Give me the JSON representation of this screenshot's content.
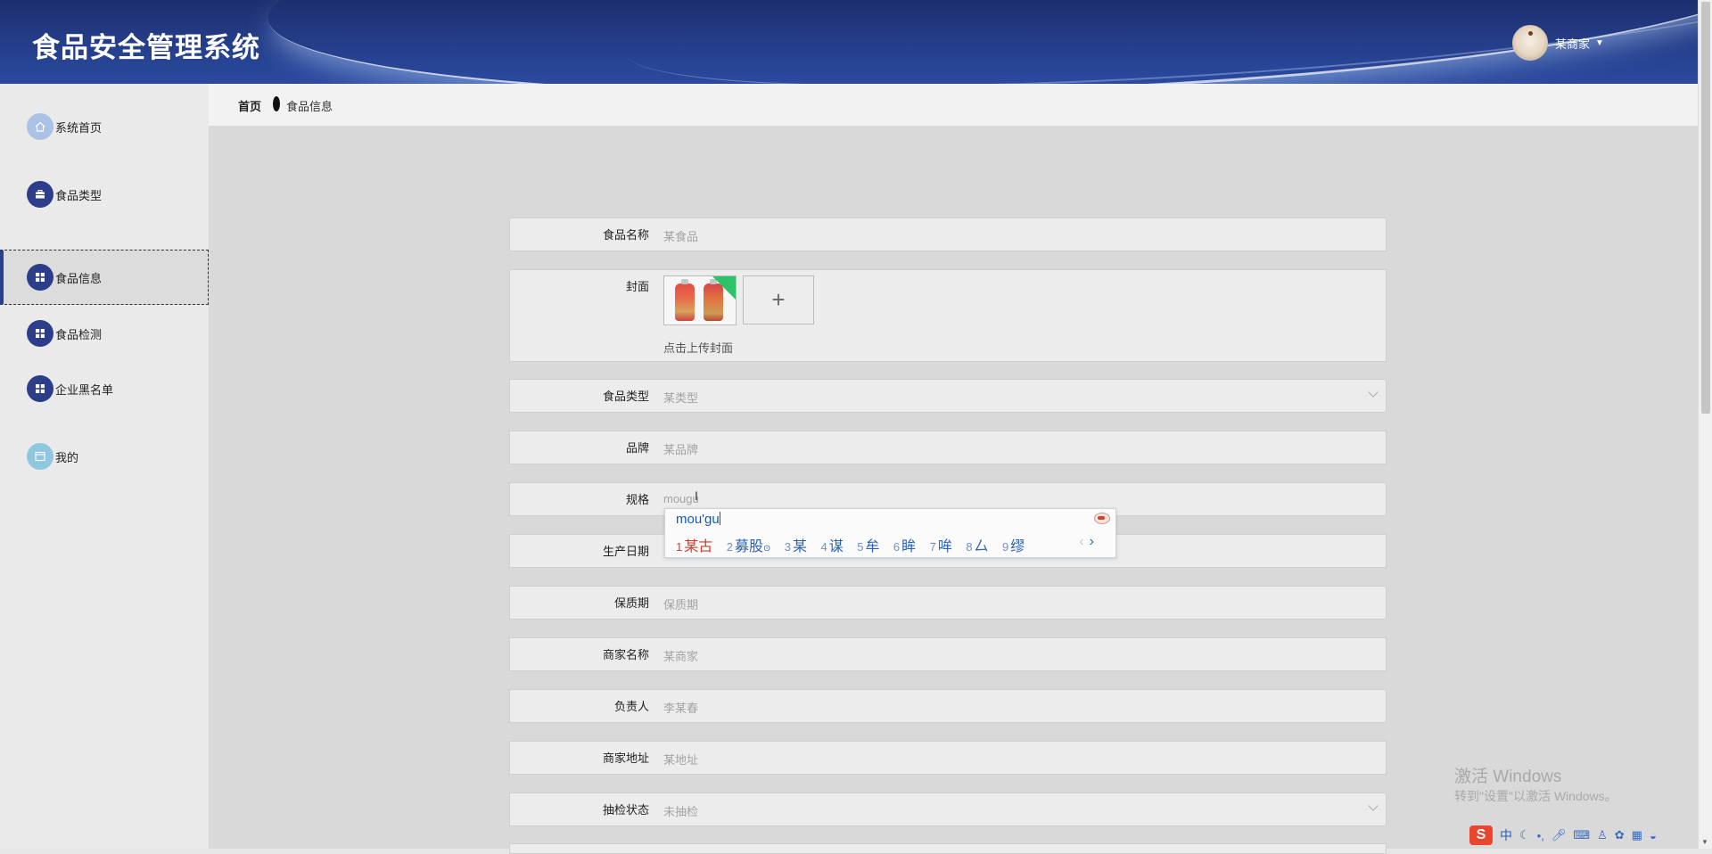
{
  "header": {
    "title": "食品安全管理系统",
    "user_name": "某商家"
  },
  "sidebar": {
    "items": [
      {
        "label": "系统首页",
        "icon": "home-icon"
      },
      {
        "label": "食品类型",
        "icon": "briefcase-icon"
      },
      {
        "label": "食品信息",
        "icon": "grid-icon",
        "active": true
      },
      {
        "label": "食品检测",
        "icon": "grid-icon"
      },
      {
        "label": "企业黑名单",
        "icon": "grid-icon"
      },
      {
        "label": "我的",
        "icon": "window-icon"
      }
    ]
  },
  "breadcrumb": {
    "home": "首页",
    "current": "食品信息"
  },
  "form": {
    "food_name": {
      "label": "食品名称",
      "placeholder": "某食品"
    },
    "cover": {
      "label": "封面",
      "hint": "点击上传封面",
      "add": "+"
    },
    "food_type": {
      "label": "食品类型",
      "placeholder": "某类型"
    },
    "brand": {
      "label": "品牌",
      "placeholder": "某品牌"
    },
    "spec": {
      "label": "规格",
      "value": "mougu"
    },
    "production_date": {
      "label": "生产日期"
    },
    "shelf_life": {
      "label": "保质期",
      "placeholder": "保质期"
    },
    "merchant_name": {
      "label": "商家名称",
      "placeholder": "某商家"
    },
    "person_in_charge": {
      "label": "负责人",
      "placeholder": "李某春"
    },
    "merchant_address": {
      "label": "商家地址",
      "placeholder": "某地址"
    },
    "inspection_status": {
      "label": "抽检状态",
      "placeholder": "未抽检"
    }
  },
  "ime": {
    "composition": "mou'gu",
    "candidates": [
      {
        "n": "1",
        "text": "某古"
      },
      {
        "n": "2",
        "text": "募股"
      },
      {
        "n": "3",
        "text": "某"
      },
      {
        "n": "4",
        "text": "谋"
      },
      {
        "n": "5",
        "text": "牟"
      },
      {
        "n": "6",
        "text": "眸"
      },
      {
        "n": "7",
        "text": "哞"
      },
      {
        "n": "8",
        "text": "厶"
      },
      {
        "n": "9",
        "text": "缪"
      }
    ],
    "toolbar": {
      "logo": "S",
      "mode": "中"
    }
  },
  "watermark": {
    "line1": "激活 Windows",
    "line2": "转到\"设置\"以激活 Windows。"
  },
  "colors": {
    "header_bg": "#243c86",
    "nav_icon": "#2c3e8a",
    "ime_candidate": "#2b62b8",
    "ime_first": "#d23a2a"
  }
}
